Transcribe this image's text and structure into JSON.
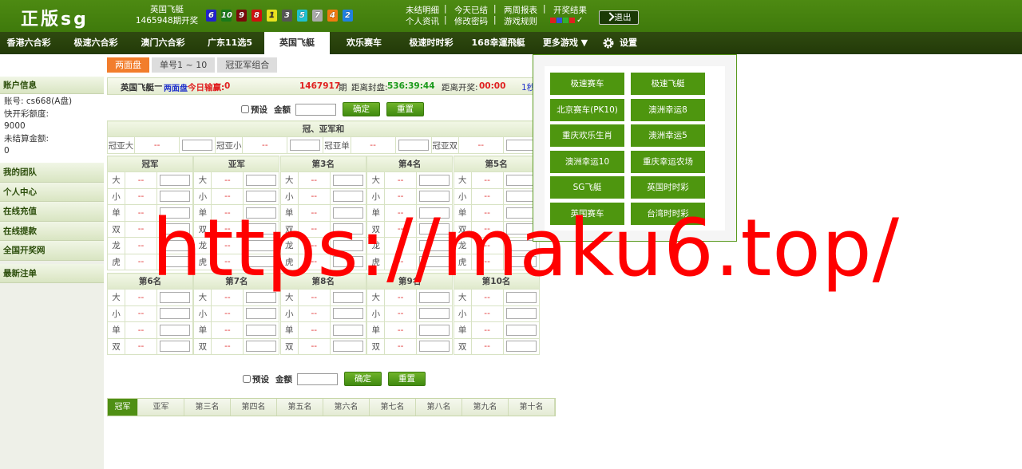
{
  "header": {
    "logo": "正版sg",
    "game_name": "英国飞艇",
    "draw_info": "1465948期开奖",
    "balls": [
      {
        "num": "6",
        "color": "#2222cc"
      },
      {
        "num": "10",
        "color": "#1a7a1a"
      },
      {
        "num": "9",
        "color": "#7a0a0a"
      },
      {
        "num": "8",
        "color": "#d01010"
      },
      {
        "num": "1",
        "color": "#e8e020"
      },
      {
        "num": "3",
        "color": "#555555"
      },
      {
        "num": "5",
        "color": "#20c0d0"
      },
      {
        "num": "7",
        "color": "#aaaaaa"
      },
      {
        "num": "4",
        "color": "#f07a10"
      },
      {
        "num": "2",
        "color": "#2080e0"
      }
    ],
    "links": [
      "未结明细",
      "今天已结",
      "两周报表",
      "开奖结果",
      "个人资讯",
      "修改密码",
      "游戏规则"
    ],
    "logout": "退出",
    "check": "✓",
    "square_colors": [
      "#e02020",
      "#3050e0",
      "#30b030",
      "#e02020"
    ]
  },
  "nav": {
    "items": [
      "香港六合彩",
      "极速六合彩",
      "澳门六合彩",
      "广东11选5",
      "英国飞艇",
      "欢乐赛车",
      "极速时时彩",
      "168幸運飛艇",
      "更多游戏 ▼",
      "设置"
    ],
    "active_index": 4
  },
  "subtabs": [
    "两面盘",
    "单号1 ~ 10",
    "冠亚军组合"
  ],
  "sidebar": {
    "account_title": "账户信息",
    "account_line": "账号:    cs668(A盘)",
    "quick_label": "快开彩额度:",
    "quick_value": "9000",
    "unsettled_label": "未结算金额:",
    "unsettled_value": "0",
    "links": [
      "我的团队",
      "个人中心",
      "在线充值",
      "在线提款",
      "全国开奖网",
      "最新注单"
    ]
  },
  "infobar": {
    "game": "英国飞艇",
    "dash": "—",
    "mode": "两面盘",
    "winlose_label": "今日输赢:",
    "winlose_value": "0",
    "period": "1467917",
    "period_suffix": "期",
    "close_label": "距离封盘:",
    "close_time": "536:39:44",
    "draw_label": "距离开奖:",
    "draw_time": "00:00",
    "refresh": "1秒"
  },
  "form": {
    "preset": "预设",
    "amount": "金额",
    "confirm": "确定",
    "reset": "重置"
  },
  "gyh": {
    "title": "冠、亚军和",
    "labels": [
      "冠亚大",
      "冠亚小",
      "冠亚单",
      "冠亚双"
    ],
    "odds": "--"
  },
  "groups1": {
    "titles": [
      "冠军",
      "亚军",
      "第3名",
      "第4名",
      "第5名"
    ],
    "rows": [
      "大",
      "小",
      "单",
      "双",
      "龙",
      "虎"
    ],
    "odds": "--"
  },
  "groups2": {
    "titles": [
      "第6名",
      "第7名",
      "第8名",
      "第9名",
      "第10名"
    ],
    "rows": [
      "大",
      "小",
      "单",
      "双"
    ],
    "odds": "--"
  },
  "bottom_tabs": [
    "冠军",
    "亚军",
    "第三名",
    "第四名",
    "第五名",
    "第六名",
    "第七名",
    "第八名",
    "第九名",
    "第十名"
  ],
  "dropdown": {
    "games": [
      "极速赛车",
      "极速飞艇",
      "北京赛车(PK10)",
      "澳洲幸运8",
      "重庆欢乐生肖",
      "澳洲幸运5",
      "澳洲幸运10",
      "重庆幸运农场",
      "SG飞艇",
      "英国时时彩",
      "英国赛车",
      "台湾时时彩"
    ]
  },
  "watermark": "https://maku6.top/"
}
